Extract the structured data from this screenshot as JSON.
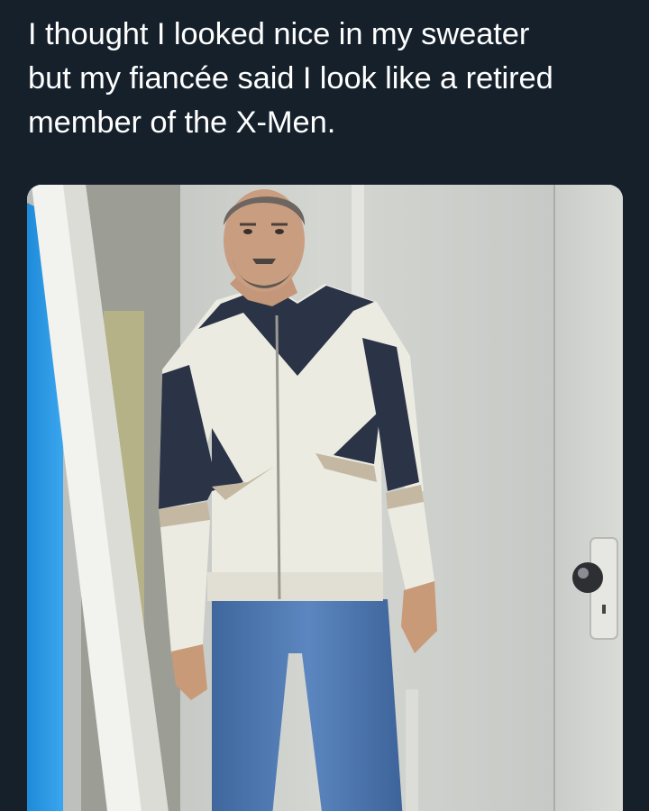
{
  "tweet": {
    "text_lines": [
      "I thought I looked nice in my sweater",
      "but my fiancée said I look like a retired",
      "member of the X-Men."
    ]
  },
  "media": {
    "description_name": "photo-man-in-sweater",
    "colors": {
      "background": "#15202b",
      "text": "#ffffff",
      "door_blue": "#2f9be6",
      "wall": "#cdd0cc",
      "sweater_white": "#ecebe2",
      "sweater_navy": "#2b3347",
      "sweater_tan": "#c4b8a3",
      "jeans": "#4f78b3"
    }
  }
}
